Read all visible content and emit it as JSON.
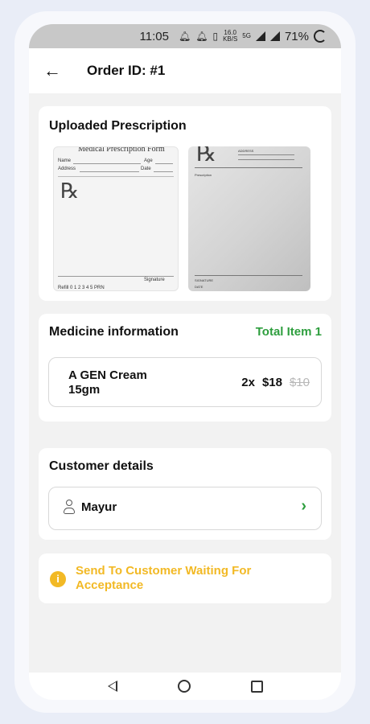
{
  "status_bar": {
    "time": "11:05",
    "data_speed": "16.0",
    "data_unit": "KB/S",
    "network": "5G",
    "battery": "71%"
  },
  "header": {
    "back_icon": "arrow-left-icon",
    "title": "Order ID: #1"
  },
  "prescription": {
    "title": "Uploaded Prescription",
    "images": [
      {
        "heading": "Medical Prescription Form",
        "name_label": "Name",
        "age_label": "Age",
        "address_label": "Address",
        "date_label": "Date",
        "signature_label": "Signature",
        "refill_label": "Refill 0 1 2 3 4 5 PRN"
      },
      {
        "address_label": "ADDRESS",
        "prescription_label": "Prescription",
        "signature_label": "SIGNATURE",
        "date_label": "DATE"
      }
    ]
  },
  "medicine": {
    "title": "Medicine information",
    "total_items": "Total Item 1",
    "items": [
      {
        "name": "A GEN Cream 15gm",
        "quantity": "2x",
        "price": "$18",
        "original_price": "$10"
      }
    ]
  },
  "customer": {
    "title": "Customer details",
    "name": "Mayur"
  },
  "order_status": {
    "text": "Send To Customer Waiting For Acceptance",
    "color": "#f2b925"
  },
  "colors": {
    "accent_green": "#2e9e3e",
    "warning_yellow": "#f2b925"
  }
}
